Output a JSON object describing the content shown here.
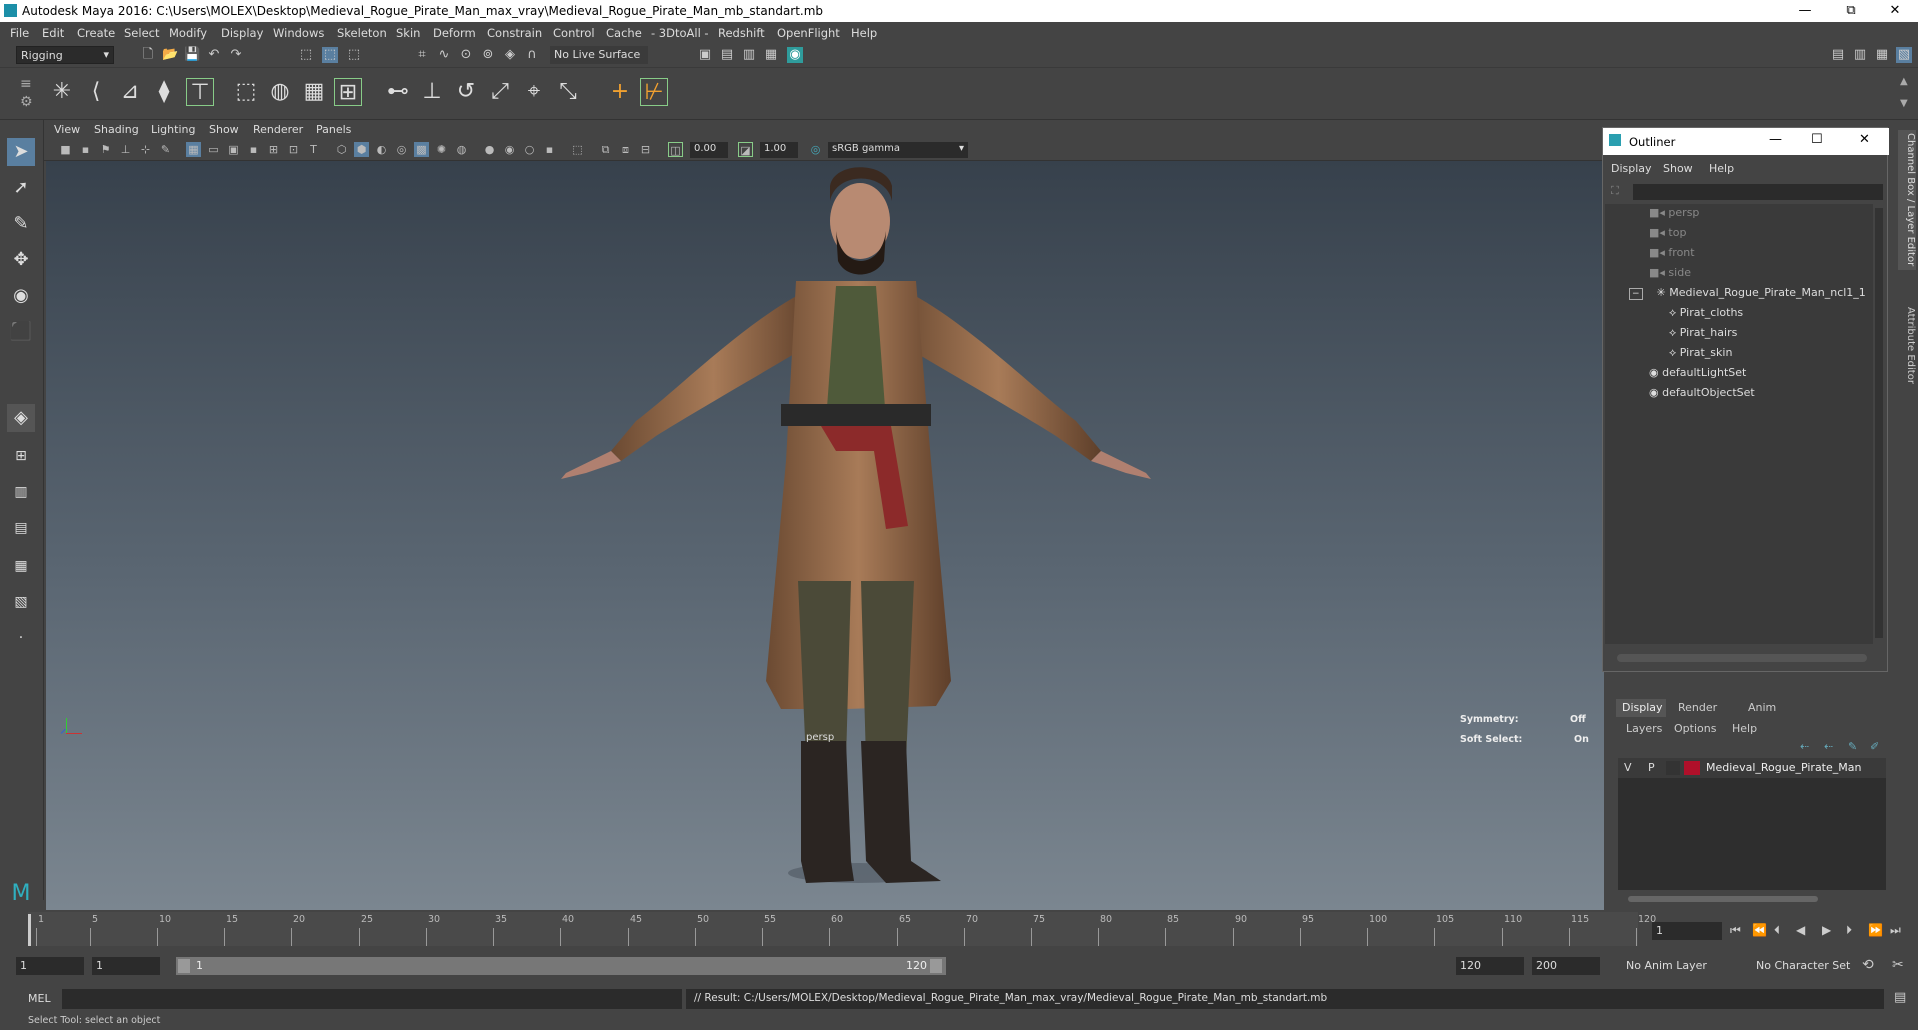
{
  "window": {
    "title": "Autodesk Maya 2016: C:\\Users\\MOLEX\\Desktop\\Medieval_Rogue_Pirate_Man_max_vray\\Medieval_Rogue_Pirate_Man_mb_standart.mb",
    "minimize": "—",
    "restore": "⧉",
    "close": "✕"
  },
  "menubar": [
    "File",
    "Edit",
    "Create",
    "Select",
    "Modify",
    "Display",
    "Windows",
    "Skeleton",
    "Skin",
    "Deform",
    "Constrain",
    "Control",
    "Cache",
    "- 3DtoAll -",
    "Redshift",
    "OpenFlight",
    "Help"
  ],
  "shelf": {
    "mode": "Rigging",
    "live_surface": "No Live Surface"
  },
  "panel_menu": [
    "View",
    "Shading",
    "Lighting",
    "Show",
    "Renderer",
    "Panels"
  ],
  "panel_toolbar": {
    "exposure": "0.00",
    "gamma": "1.00",
    "colorspace": "sRGB gamma"
  },
  "viewport": {
    "camera_label": "persp",
    "symmetry_label": "Symmetry:",
    "symmetry_value": "Off",
    "soft_select_label": "Soft Select:",
    "soft_select_value": "On"
  },
  "outliner": {
    "title": "Outliner",
    "menus": [
      "Display",
      "Show",
      "Help"
    ],
    "items": [
      {
        "label": "persp",
        "icon": "camera-icon"
      },
      {
        "label": "top",
        "icon": "camera-icon"
      },
      {
        "label": "front",
        "icon": "camera-icon"
      },
      {
        "label": "side",
        "icon": "camera-icon"
      },
      {
        "label": "Medieval_Rogue_Pirate_Man_ncl1_1",
        "icon": "group-icon"
      },
      {
        "label": "Pirat_cloths",
        "icon": "mesh-icon"
      },
      {
        "label": "Pirat_hairs",
        "icon": "mesh-icon"
      },
      {
        "label": "Pirat_skin",
        "icon": "mesh-icon"
      },
      {
        "label": "defaultLightSet",
        "icon": "set-icon"
      },
      {
        "label": "defaultObjectSet",
        "icon": "set-icon"
      }
    ]
  },
  "layer_editor": {
    "tabs": [
      "Display",
      "Render",
      "Anim"
    ],
    "active_tab": "Display",
    "menus": [
      "Layers",
      "Options",
      "Help"
    ],
    "layer": {
      "v": "V",
      "p": "P",
      "name": "Medieval_Rogue_Pirate_Man",
      "color": "#b0102a"
    }
  },
  "side_tabs": [
    "Channel Box / Layer Editor",
    "Attribute Editor"
  ],
  "timeline": {
    "ticks": [
      "1",
      "5",
      "10",
      "15",
      "20",
      "25",
      "30",
      "35",
      "40",
      "45",
      "50",
      "55",
      "60",
      "65",
      "70",
      "75",
      "80",
      "85",
      "90",
      "95",
      "100",
      "105",
      "110",
      "115",
      "120"
    ],
    "current_frame": "1"
  },
  "range": {
    "start": "1",
    "anim_start": "1",
    "slider_start": "1",
    "slider_end": "120",
    "range_end": "120",
    "anim_end": "200",
    "anim_layer": "No Anim Layer",
    "char_set": "No Character Set"
  },
  "command": {
    "lang": "MEL",
    "result": "// Result: C:/Users/MOLEX/Desktop/Medieval_Rogue_Pirate_Man_max_vray/Medieval_Rogue_Pirate_Man_mb_standart.mb"
  },
  "help_line": "Select Tool: select an object"
}
